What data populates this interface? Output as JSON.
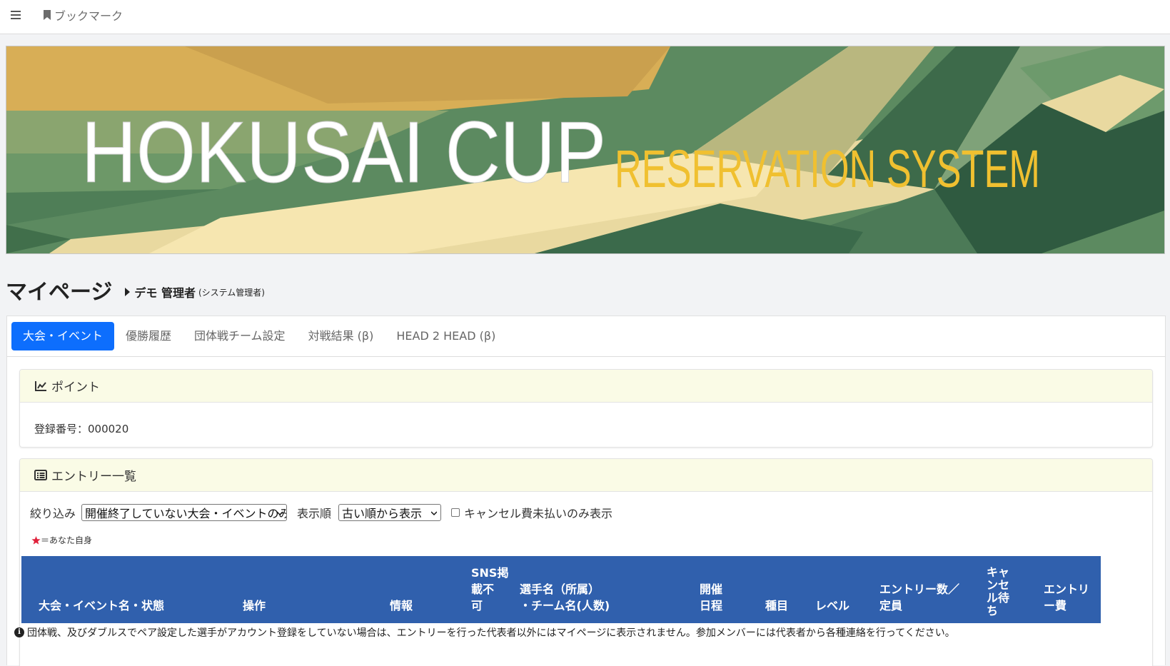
{
  "topbar": {
    "bookmark_label": "ブックマーク"
  },
  "banner": {
    "title": "HOKUSAI CUP",
    "subtitle": "RESERVATION SYSTEM"
  },
  "page": {
    "title": "マイページ",
    "user_name": "デモ 管理者",
    "user_role": "(システム管理者)"
  },
  "tabs": [
    {
      "label": "大会・イベント",
      "active": true
    },
    {
      "label": "優勝履歴",
      "active": false
    },
    {
      "label": "団体戦チーム設定",
      "active": false
    },
    {
      "label": "対戦結果 (β)",
      "active": false
    },
    {
      "label": "HEAD 2 HEAD (β)",
      "active": false
    }
  ],
  "points_card": {
    "title": "ポイント",
    "registration": "登録番号：000020"
  },
  "entry_card": {
    "title": "エントリー一覧",
    "filter_label": "絞り込み",
    "filter_value": "開催終了していない大会・イベントのみ",
    "sort_label": "表示順",
    "sort_value": "古い順から表示",
    "cancel_unpaid_label": "キャンセル費未払いのみ表示",
    "legend": "＝あなた自身",
    "columns": {
      "event": "大会・イベント名・状態",
      "action": "操作",
      "info": "情報",
      "sns": [
        "SNS掲",
        "載不",
        "可"
      ],
      "player": [
        "選手名（所属）",
        "・チーム名(人数)"
      ],
      "date": [
        "開催",
        "日程"
      ],
      "category": "種目",
      "level": "レベル",
      "count": [
        "エントリー数／",
        "定員"
      ],
      "waitlist": [
        "キャ",
        "ンセ",
        "ル待",
        "ち"
      ],
      "fee": [
        "エントリ",
        "ー費"
      ]
    }
  },
  "footnote": "団体戦、及びダブルスでペア設定した選手がアカウント登録をしていない場合は、エントリーを行った代表者以外にはマイページに表示されません。参加メンバーには代表者から各種連絡を行ってください。",
  "colors": {
    "accent": "#0d6efd",
    "table_header": "#3060ad",
    "card_header": "#fafbe6",
    "banner_gold": "#d9b25a",
    "banner_green": "#5a8a5f",
    "banner_dark_green": "#2e5a3e",
    "banner_cream": "#f6e6b0"
  }
}
